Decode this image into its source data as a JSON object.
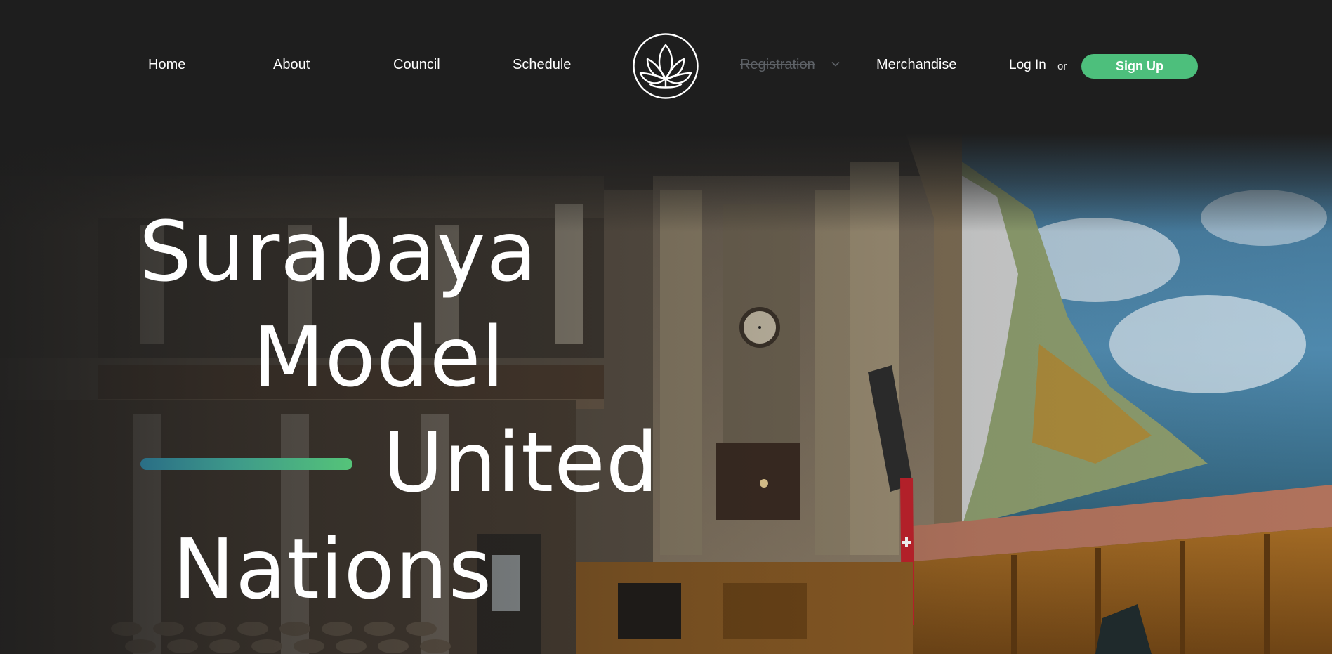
{
  "nav": {
    "home": "Home",
    "about": "About",
    "council": "Council",
    "schedule": "Schedule",
    "registration": "Registration",
    "merchandise": "Merchandise",
    "login": "Log In",
    "or": "or",
    "signup": "Sign Up"
  },
  "logo": {
    "icon": "lotus-icon"
  },
  "hero": {
    "title_words": [
      "Surabaya",
      "Model",
      "United",
      "Nations"
    ],
    "background": "parliament-chamber-photo"
  },
  "colors": {
    "background": "#1e1e1e",
    "signup_button": "#4dbf7c",
    "accent_gradient_start": "#2a6e86",
    "accent_gradient_end": "#55c479",
    "disabled_link": "#5d6166"
  }
}
